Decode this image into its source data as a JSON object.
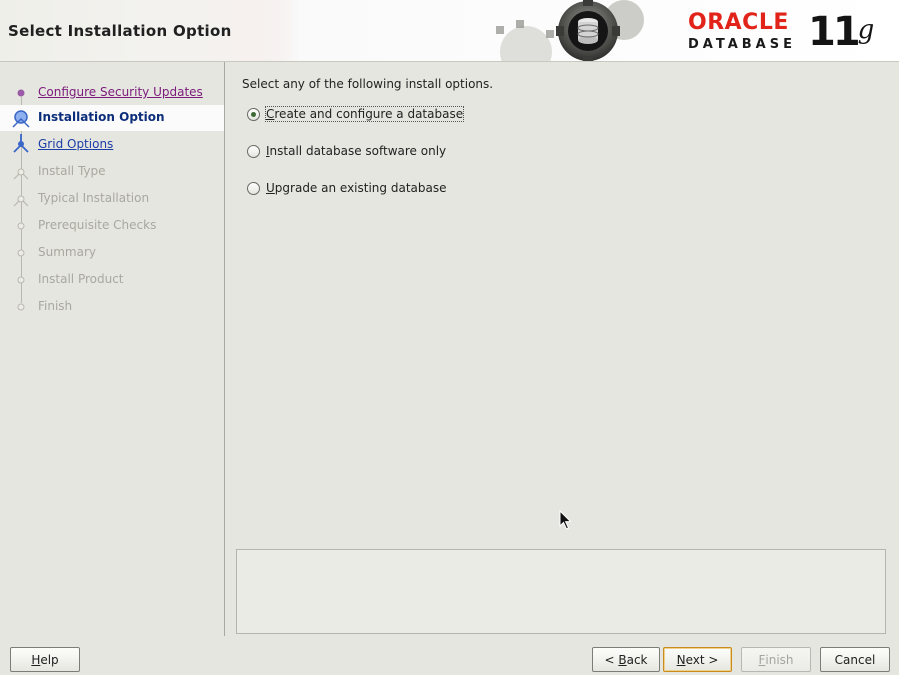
{
  "header": {
    "title": "Select Installation Option",
    "brand": "ORACLE",
    "product": "DATABASE",
    "version_number": "11",
    "version_suffix": "g",
    "brand_color": "#e2231a"
  },
  "steps": [
    {
      "label": "Configure Security Updates",
      "state": "done"
    },
    {
      "label": "Installation Option",
      "state": "current"
    },
    {
      "label": "Grid Options",
      "state": "link"
    },
    {
      "label": "Install Type",
      "state": "disabled"
    },
    {
      "label": "Typical Installation",
      "state": "disabled"
    },
    {
      "label": "Prerequisite Checks",
      "state": "disabled"
    },
    {
      "label": "Summary",
      "state": "disabled"
    },
    {
      "label": "Install Product",
      "state": "disabled"
    },
    {
      "label": "Finish",
      "state": "disabled"
    }
  ],
  "main": {
    "instruction": "Select any of the following install options.",
    "options": [
      {
        "mnemonic": "C",
        "rest": "reate and configure a database",
        "selected": true
      },
      {
        "mnemonic": "I",
        "rest": "nstall database software only",
        "selected": false
      },
      {
        "mnemonic": "U",
        "rest": "pgrade an existing database",
        "selected": false
      }
    ]
  },
  "buttons": {
    "help": {
      "mnemonic": "H",
      "rest": "elp"
    },
    "back": {
      "prefix": "< ",
      "mnemonic": "B",
      "rest": "ack"
    },
    "next": {
      "mnemonic": "N",
      "rest": "ext >"
    },
    "finish": {
      "mnemonic": "F",
      "rest": "inish",
      "enabled": false
    },
    "cancel": {
      "label": "Cancel"
    }
  }
}
